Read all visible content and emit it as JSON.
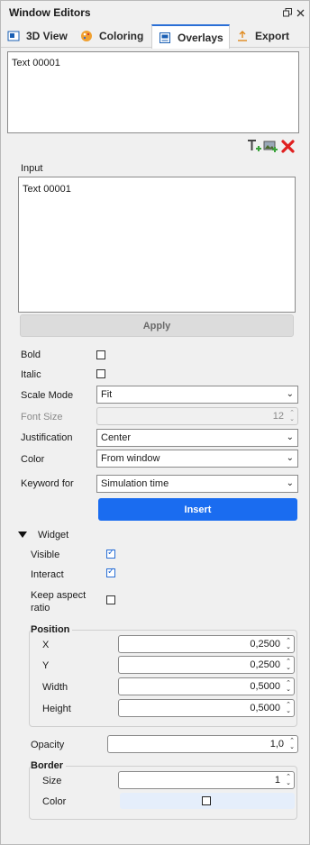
{
  "window": {
    "title": "Window Editors"
  },
  "titlebar_icons": [
    "restore-icon",
    "close-icon"
  ],
  "tabs": [
    {
      "label": "3D View",
      "icon": "3d-view-icon"
    },
    {
      "label": "Coloring",
      "icon": "palette-icon"
    },
    {
      "label": "Overlays",
      "icon": "overlays-icon",
      "active": true
    },
    {
      "label": "Export",
      "icon": "export-icon"
    }
  ],
  "overlay_list": {
    "items": [
      "Text 00001"
    ]
  },
  "list_toolbar": {
    "icons": [
      "add-text-icon",
      "add-image-icon",
      "delete-icon"
    ]
  },
  "input": {
    "label": "Input",
    "value": "Text 00001"
  },
  "apply": {
    "label": "Apply"
  },
  "props": {
    "bold": {
      "label": "Bold",
      "checked": false
    },
    "italic": {
      "label": "Italic",
      "checked": false
    },
    "scale_mode": {
      "label": "Scale Mode",
      "value": "Fit"
    },
    "font_size": {
      "label": "Font Size",
      "value": "12"
    },
    "justification": {
      "label": "Justification",
      "value": "Center"
    },
    "color": {
      "label": "Color",
      "value": "From window"
    },
    "keyword_for": {
      "label": "Keyword for",
      "value": "Simulation time"
    }
  },
  "insert": {
    "label": "Insert"
  },
  "widget": {
    "label": "Widget",
    "visible": {
      "label": "Visible",
      "checked": true
    },
    "interact": {
      "label": "Interact",
      "checked": true
    },
    "keep_aspect": {
      "label_line1": "Keep aspect",
      "label_line2": "ratio",
      "checked": false
    },
    "position": {
      "title": "Position",
      "x": {
        "label": "X",
        "value": "0,2500"
      },
      "y": {
        "label": "Y",
        "value": "0,2500"
      },
      "width": {
        "label": "Width",
        "value": "0,5000"
      },
      "height": {
        "label": "Height",
        "value": "0,5000"
      }
    },
    "opacity": {
      "label": "Opacity",
      "value": "1,0"
    },
    "border": {
      "title": "Border",
      "size": {
        "label": "Size",
        "value": "1"
      },
      "color": {
        "label": "Color"
      }
    }
  },
  "colors": {
    "accent": "#1a6cf0",
    "tab_active_border": "#2a6fd6",
    "delete_red": "#e02020",
    "add_green": "#3aa33a"
  }
}
